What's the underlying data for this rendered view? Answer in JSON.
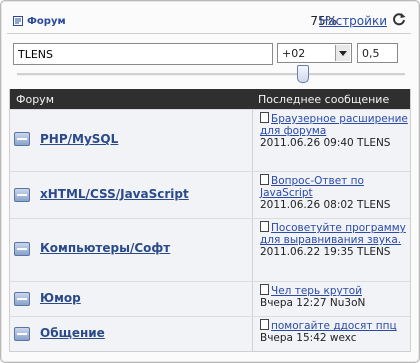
{
  "header": {
    "forum_label": "Форум",
    "zoom": "75%",
    "settings_label": "Настройки"
  },
  "search": {
    "value": "TLENS",
    "timezone": "+02",
    "step": "0,5"
  },
  "slider": {
    "level_fraction": 0.72
  },
  "table": {
    "col_forum": "Форум",
    "col_last": "Последнее сообщение",
    "rows": [
      {
        "name": "PHP/MySQL",
        "post": "Браузерное расширение для форума",
        "meta": "2011.06.26 09:40 TLENS"
      },
      {
        "name": "xHTML/CSS/JavaScript",
        "post": "Вопрос-Ответ по JavaScript",
        "meta": "2011.06.26 08:02 TLENS"
      },
      {
        "name": "Компьютеры/Софт",
        "post": "Посоветуйте программу для выравнивания звука.",
        "meta": "2011.06.22 19:35 TLENS"
      },
      {
        "name": "Юмор",
        "post": "Чел терь крутой",
        "meta": "Вчера 12:27 Nu3oN"
      },
      {
        "name": "Общение",
        "post": "помогайте ддосят ппц",
        "meta": "Вчера 15:42 wexc"
      }
    ]
  },
  "icons": {
    "forum": "forum-icon",
    "refresh": "refresh-icon",
    "bullet": "forum-bullet-icon",
    "post": "document-icon"
  },
  "colors": {
    "link": "#2a4a8a",
    "header_bg": "#2f2f2f"
  }
}
